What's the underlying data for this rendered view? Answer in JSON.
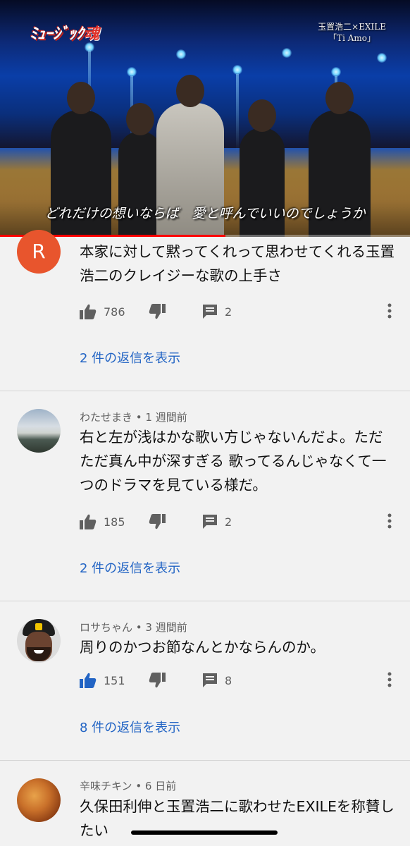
{
  "video": {
    "logo_text": "ﾐｭｰｼﾞｯｸ",
    "logo_kanji": "魂",
    "credit_line1": "玉置浩二×EXILE",
    "credit_line2": "「Ti Amo」",
    "subtitle": "どれだけの想いならば　愛と呼んでいいのでしょうか",
    "progress": 0.55
  },
  "comments": [
    {
      "avatar_letter": "R",
      "meta": "",
      "body": "本家に対して黙ってくれって思わせてくれる玉置浩二のクレイジーな歌の上手さ",
      "likes": "786",
      "replies_count": "2",
      "view_replies": "2 件の返信を表示",
      "liked": false
    },
    {
      "meta": "わたせまき • 1 週間前",
      "body": "右と左が浅はかな歌い方じゃないんだよ。ただただ真ん中が深すぎる 歌ってるんじゃなくて一つのドラマを見ている様だ。",
      "likes": "185",
      "replies_count": "2",
      "view_replies": "2 件の返信を表示",
      "liked": false
    },
    {
      "meta": "ロサちゃん • 3 週間前",
      "body": "周りのかつお節なんとかならんのか。",
      "likes": "151",
      "replies_count": "8",
      "view_replies": "8 件の返信を表示",
      "liked": true
    },
    {
      "meta": "辛味チキン • 6 日前",
      "body": "久保田利伸と玉置浩二に歌わせたEXILEを称賛したい"
    }
  ],
  "colors": {
    "link_blue": "#2264c4",
    "like_active": "#2264c4",
    "icon_gray": "#606060",
    "progress_red": "#ff0000"
  },
  "icons": {
    "like": "thumb-up-icon",
    "dislike": "thumb-down-icon",
    "reply": "comment-icon",
    "more": "more-vert-icon"
  }
}
